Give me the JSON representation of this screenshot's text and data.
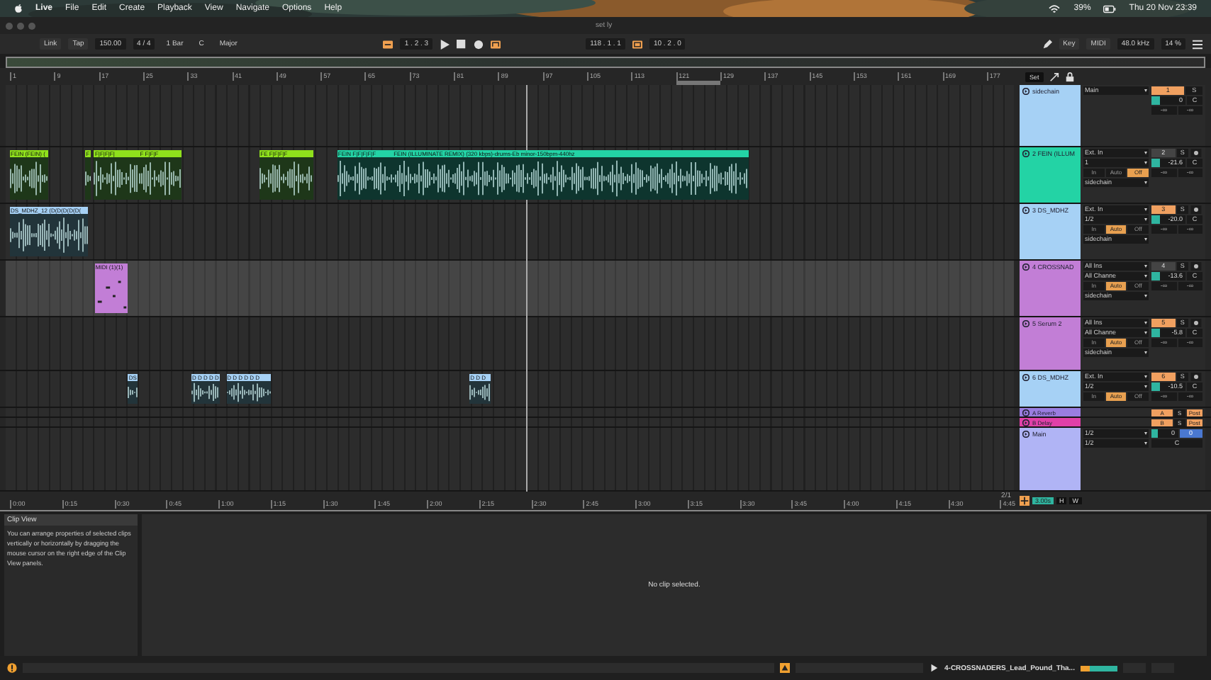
{
  "menu_bar": {
    "app": "Live",
    "items": [
      "File",
      "Edit",
      "Create",
      "Playback",
      "View",
      "Navigate",
      "Options",
      "Help"
    ],
    "battery": "39%",
    "clock": "Thu 20 Nov  23:39"
  },
  "window": {
    "title": "set ly"
  },
  "control_bar": {
    "left": [
      {
        "text": "Link",
        "kind": "button"
      },
      {
        "text": "Tap",
        "kind": "button"
      },
      {
        "text": "150.00",
        "kind": "field"
      },
      {
        "text": "4 / 4",
        "kind": "field"
      },
      {
        "text": "1 Bar",
        "kind": "select"
      },
      {
        "text": "C",
        "kind": "select"
      },
      {
        "text": "Major",
        "kind": "select"
      }
    ],
    "position": "1 .  2 .  3",
    "loop_start": "118 .  1 .  1",
    "loop_length": "10 .  2 .  0",
    "right": [
      {
        "text": "Key",
        "kind": "button"
      },
      {
        "text": "MIDI",
        "kind": "button"
      },
      {
        "text": "48.0 kHz",
        "kind": "field"
      },
      {
        "text": "14 %",
        "kind": "field"
      }
    ]
  },
  "ruler": {
    "bars": [
      "1",
      "9",
      "17",
      "25",
      "33",
      "41",
      "49",
      "57",
      "65",
      "73",
      "81",
      "89",
      "97",
      "105",
      "113",
      "121",
      "129",
      "137",
      "145",
      "153",
      "161",
      "169",
      "177"
    ],
    "set_button": "Set"
  },
  "tracks": [
    {
      "name": "sidechain",
      "color": "#a6d1f5",
      "selected": false,
      "io": [
        [
          {
            "kind": "select",
            "text": "Main"
          }
        ]
      ],
      "mixer": [
        [
          {
            "kind": "num-on",
            "text": "1"
          },
          {
            "kind": "solo",
            "text": "S"
          }
        ],
        [
          {
            "kind": "vol",
            "text": "0"
          },
          {
            "kind": "pan",
            "text": "C"
          }
        ],
        [
          {
            "kind": "send",
            "text": "-∞"
          },
          {
            "kind": "send",
            "text": "-∞"
          }
        ]
      ]
    },
    {
      "name": "2 FEIN (ILLUM",
      "color": "#23d3a5",
      "selected": false,
      "clips": [
        {
          "label": "FEIN (FEIN) (",
          "color": "#8fe01c",
          "kind": "audio"
        },
        {
          "label": "F",
          "color": "#8fe01c",
          "kind": "audio"
        },
        {
          "label": "F|F|F|F|",
          "color": "#8fe01c",
          "kind": "audio"
        },
        {
          "label": "F F|F|F",
          "color": "#8fe01c",
          "kind": "audio"
        },
        {
          "label": "FE F|F|F|F",
          "color": "#8fe01c",
          "kind": "audio"
        },
        {
          "label": "FEIN F|F|F|F|F",
          "color": "#23d3a5",
          "kind": "audio"
        },
        {
          "label": "FEIN (ILLUMINATE REMIX) (320 kbps)-drums-Eb minor-150bpm-440hz",
          "color": "#23d3a5",
          "kind": "audio"
        }
      ],
      "io": [
        [
          {
            "kind": "select",
            "text": "Ext. In"
          }
        ],
        [
          {
            "kind": "select",
            "text": "1"
          }
        ],
        [
          {
            "kind": "monitor",
            "text": "In",
            "selected": false
          },
          {
            "kind": "monitor",
            "text": "Auto",
            "selected": false
          },
          {
            "kind": "monitor",
            "text": "Off",
            "selected": true
          }
        ],
        [
          {
            "kind": "select",
            "text": "sidechain"
          }
        ]
      ],
      "mixer": [
        [
          {
            "kind": "num-off",
            "text": "2"
          },
          {
            "kind": "solo",
            "text": "S"
          },
          {
            "kind": "arm"
          }
        ],
        [
          {
            "kind": "vol",
            "text": "-21.6"
          },
          {
            "kind": "pan",
            "text": "C"
          }
        ],
        [
          {
            "kind": "send",
            "text": "-∞"
          },
          {
            "kind": "send",
            "text": "-∞"
          }
        ]
      ]
    },
    {
      "name": "3 DS_MDHZ",
      "color": "#a6d1f5",
      "selected": false,
      "clips": [
        {
          "label": "DS_MDHZ_12 (D(D(D(D(D(",
          "color": "#a6d1f5",
          "kind": "audio"
        }
      ],
      "io": [
        [
          {
            "kind": "select",
            "text": "Ext. In"
          }
        ],
        [
          {
            "kind": "select",
            "text": "1/2"
          }
        ],
        [
          {
            "kind": "monitor",
            "text": "In",
            "selected": false
          },
          {
            "kind": "monitor",
            "text": "Auto",
            "selected": true
          },
          {
            "kind": "monitor",
            "text": "Off",
            "selected": false
          }
        ],
        [
          {
            "kind": "select",
            "text": "sidechain"
          }
        ]
      ],
      "mixer": [
        [
          {
            "kind": "num-on",
            "text": "3"
          },
          {
            "kind": "solo",
            "text": "S"
          },
          {
            "kind": "arm"
          }
        ],
        [
          {
            "kind": "vol",
            "text": "-20.0"
          },
          {
            "kind": "pan",
            "text": "C"
          }
        ],
        [
          {
            "kind": "send",
            "text": "-∞"
          },
          {
            "kind": "send",
            "text": "-∞"
          }
        ]
      ]
    },
    {
      "name": "4 CROSSNAD",
      "color": "#c27ed6",
      "selected": true,
      "clips": [
        {
          "label": "MIDI (1)(1)",
          "color": "#c27ed6",
          "kind": "midi"
        }
      ],
      "io": [
        [
          {
            "kind": "select",
            "text": "All Ins"
          }
        ],
        [
          {
            "kind": "select",
            "text": "All Channe"
          }
        ],
        [
          {
            "kind": "monitor",
            "text": "In",
            "selected": false
          },
          {
            "kind": "monitor",
            "text": "Auto",
            "selected": true
          },
          {
            "kind": "monitor",
            "text": "Off",
            "selected": false
          }
        ],
        [
          {
            "kind": "select",
            "text": "sidechain"
          }
        ]
      ],
      "mixer": [
        [
          {
            "kind": "num-off",
            "text": "4"
          },
          {
            "kind": "solo",
            "text": "S"
          },
          {
            "kind": "arm"
          }
        ],
        [
          {
            "kind": "vol",
            "text": "-13.6"
          },
          {
            "kind": "pan",
            "text": "C"
          }
        ],
        [
          {
            "kind": "send",
            "text": "-∞"
          },
          {
            "kind": "send",
            "text": "-∞"
          }
        ]
      ]
    },
    {
      "name": "5 Serum 2",
      "color": "#c27ed6",
      "selected": false,
      "io": [
        [
          {
            "kind": "select",
            "text": "All Ins"
          }
        ],
        [
          {
            "kind": "select",
            "text": "All Channe"
          }
        ],
        [
          {
            "kind": "monitor",
            "text": "In",
            "selected": false
          },
          {
            "kind": "monitor",
            "text": "Auto",
            "selected": true
          },
          {
            "kind": "monitor",
            "text": "Off",
            "selected": false
          }
        ],
        [
          {
            "kind": "select",
            "text": "sidechain"
          }
        ]
      ],
      "mixer": [
        [
          {
            "kind": "num-on",
            "text": "5"
          },
          {
            "kind": "solo",
            "text": "S"
          },
          {
            "kind": "arm"
          }
        ],
        [
          {
            "kind": "vol",
            "text": "-5.8"
          },
          {
            "kind": "pan",
            "text": "C"
          }
        ],
        [
          {
            "kind": "send",
            "text": "-∞"
          },
          {
            "kind": "send",
            "text": "-∞"
          }
        ]
      ]
    },
    {
      "name": "6 DS_MDHZ",
      "color": "#a6d1f5",
      "selected": false,
      "clips": [
        {
          "label": "DS",
          "color": "#a6d1f5",
          "kind": "audio"
        },
        {
          "label": "D D D D D",
          "color": "#a6d1f5",
          "kind": "audio"
        },
        {
          "label": "D D D D D D",
          "color": "#a6d1f5",
          "kind": "audio"
        },
        {
          "label": "D D D",
          "color": "#a6d1f5",
          "kind": "audio"
        }
      ],
      "io": [
        [
          {
            "kind": "select",
            "text": "Ext. In"
          }
        ],
        [
          {
            "kind": "select",
            "text": "1/2"
          }
        ],
        [
          {
            "kind": "monitor",
            "text": "In",
            "selected": false
          },
          {
            "kind": "monitor",
            "text": "Auto",
            "selected": true
          },
          {
            "kind": "monitor",
            "text": "Off",
            "selected": false
          }
        ]
      ],
      "mixer": [
        [
          {
            "kind": "num-on",
            "text": "6"
          },
          {
            "kind": "solo",
            "text": "S"
          },
          {
            "kind": "arm"
          }
        ],
        [
          {
            "kind": "vol",
            "text": "-10.5"
          },
          {
            "kind": "pan",
            "text": "C"
          }
        ],
        [
          {
            "kind": "send",
            "text": "-∞"
          },
          {
            "kind": "send",
            "text": "-∞"
          }
        ]
      ]
    },
    {
      "name": "A Reverb",
      "color": "#9a7de0",
      "selected": false,
      "mixer": [
        [
          {
            "kind": "num-on",
            "text": "A"
          },
          {
            "kind": "solo",
            "text": "S"
          },
          {
            "kind": "post",
            "text": "Post"
          }
        ]
      ]
    },
    {
      "name": "B Delay",
      "color": "#e040a8",
      "selected": false,
      "mixer": [
        [
          {
            "kind": "num-on",
            "text": "B"
          },
          {
            "kind": "solo",
            "text": "S"
          },
          {
            "kind": "post",
            "text": "Post"
          }
        ]
      ]
    },
    {
      "name": "Main",
      "color": "#b0b4f5",
      "selected": false,
      "io": [
        [
          {
            "kind": "select",
            "text": "1/2"
          }
        ],
        [
          {
            "kind": "select",
            "text": "1/2"
          }
        ]
      ],
      "mixer": [
        [
          {
            "kind": "vol",
            "text": "0"
          },
          {
            "kind": "blue",
            "text": "0"
          }
        ],
        [
          {
            "kind": "pan",
            "text": "C"
          }
        ]
      ]
    }
  ],
  "time_ruler": {
    "times": [
      "0:00",
      "0:15",
      "0:30",
      "0:45",
      "1:00",
      "1:15",
      "1:30",
      "1:45",
      "2:00",
      "2:15",
      "2:30",
      "2:45",
      "3:00",
      "3:15",
      "3:30",
      "3:45",
      "4:00",
      "4:15",
      "4:30",
      "4:45"
    ],
    "zoom": "2/1",
    "delay": "3.00s",
    "buttons": [
      "H",
      "W"
    ]
  },
  "clip_view": {
    "title": "Clip View",
    "help": "You can arrange properties of selected clips vertically or horizontally by dragging the mouse cursor on the right edge of the Clip View panels.",
    "message": "No clip selected."
  },
  "status_bar": {
    "file": "4-CROSSNADERS_Lead_Pound_Tha..."
  }
}
